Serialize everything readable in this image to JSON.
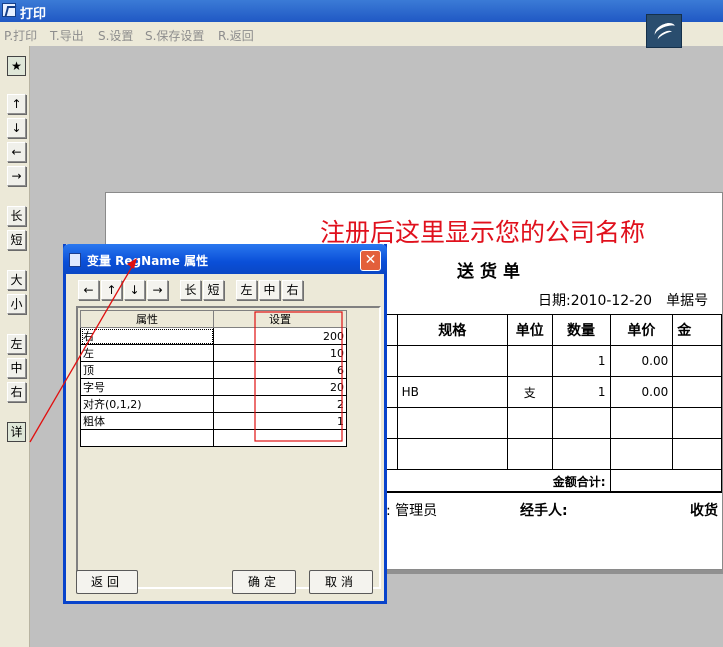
{
  "window": {
    "title": "打印"
  },
  "menu": [
    {
      "label": "P.打印"
    },
    {
      "label": "T.导出"
    },
    {
      "label": "S.设置"
    },
    {
      "label": "S.保存设置"
    },
    {
      "label": "R.返回"
    }
  ],
  "toolbar": {
    "star": "★",
    "up": "↑",
    "down": "↓",
    "left": "←",
    "right": "→",
    "long": "长",
    "short": "短",
    "big": "大",
    "small": "小",
    "align_left": "左",
    "align_center": "中",
    "align_right": "右",
    "detail": "详"
  },
  "paper": {
    "company": "注册后这里显示您的公司名称",
    "doc_title": "送货单",
    "date_label": "日期:",
    "date_value": "2010-12-20",
    "bill_no_label": "单据号",
    "headers": [
      "",
      "规格",
      "单位",
      "数量",
      "单价",
      "金"
    ],
    "rows": [
      [
        "",
        "",
        "",
        "1",
        "0.00",
        ""
      ],
      [
        "",
        "HB",
        "支",
        "1",
        "0.00",
        ""
      ],
      [
        "",
        "",
        "",
        "",
        "",
        ""
      ],
      [
        "",
        "",
        "",
        "",
        "",
        ""
      ]
    ],
    "total_label": "金额合计:",
    "footer_maker_label": ":",
    "footer_maker_value": "管理员",
    "footer_handler_label": "经手人:",
    "footer_receiver_label": "收货"
  },
  "dialog": {
    "title": "变量 RegName 属性",
    "close": "✕",
    "buttons_top": [
      "←",
      "↑",
      "↓",
      "→",
      "长",
      "短",
      "左",
      "中",
      "右"
    ],
    "col_property": "属性",
    "col_setting": "设置",
    "properties": [
      {
        "name": "右",
        "value": "200"
      },
      {
        "name": "左",
        "value": "10"
      },
      {
        "name": "顶",
        "value": "6"
      },
      {
        "name": "字号",
        "value": "20"
      },
      {
        "name": "对齐(0,1,2)",
        "value": "2"
      },
      {
        "name": "粗体",
        "value": "1"
      },
      {
        "name": "",
        "value": ""
      }
    ],
    "back_label": "返回",
    "ok_label": "确定",
    "cancel_label": "取消"
  },
  "colors": {
    "company_red": "#e0101c",
    "dialog_blue": "#0843cb",
    "annotation_red": "#e01010"
  }
}
